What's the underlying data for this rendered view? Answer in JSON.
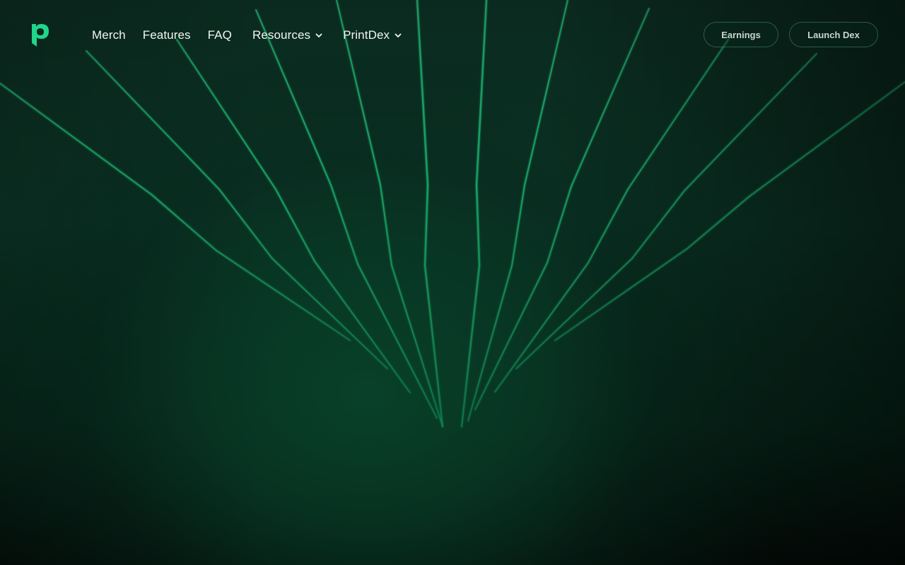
{
  "brand": {
    "logo_icon": "p-logo-icon",
    "accent_color": "#1fd68a"
  },
  "nav": {
    "items": [
      {
        "label": "Merch",
        "has_dropdown": false
      },
      {
        "label": "Features",
        "has_dropdown": false
      },
      {
        "label": "FAQ",
        "has_dropdown": false
      },
      {
        "label": "Resources",
        "has_dropdown": true,
        "icon": "chevron-down-icon"
      },
      {
        "label": "PrintDex",
        "has_dropdown": true,
        "icon": "chevron-down-icon"
      }
    ],
    "earnings_label": "Earnings",
    "launch_label": "Launch Dex"
  },
  "hero": {
    "background_color": "#0a3324",
    "ray_color": "#1fae6b"
  }
}
